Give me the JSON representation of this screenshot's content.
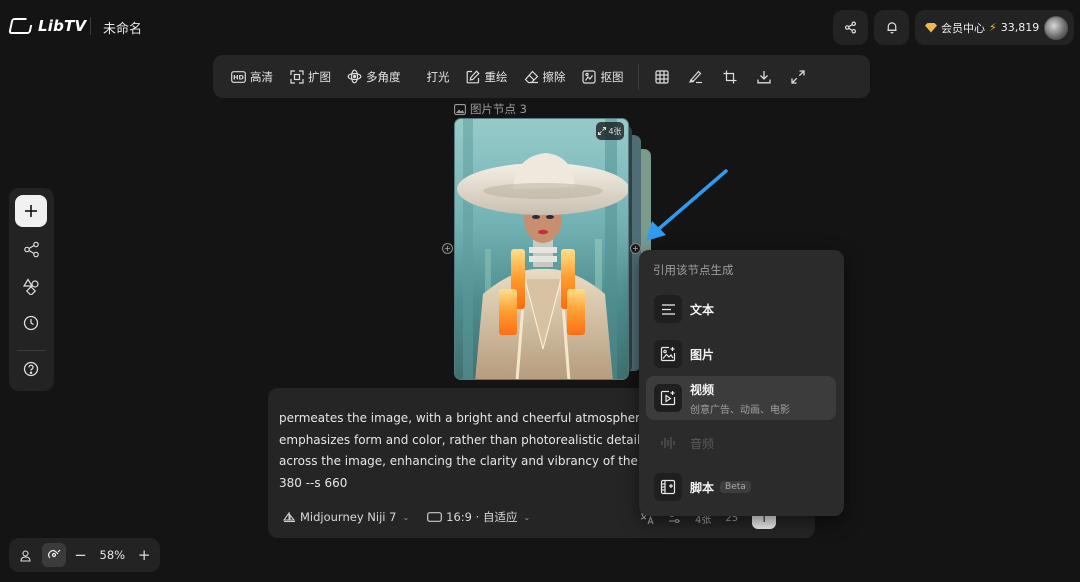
{
  "header": {
    "app_name": "LibTV",
    "doc_title": "未命名",
    "member_label": "会员中心",
    "credits": "33,819"
  },
  "toolbar": {
    "items": [
      {
        "label": "高清",
        "icon": "hd-icon"
      },
      {
        "label": "扩图",
        "icon": "expand-image-icon"
      },
      {
        "label": "多角度",
        "icon": "multi-angle-icon"
      },
      {
        "label": "打光",
        "icon": ""
      },
      {
        "label": "重绘",
        "icon": "redraw-icon"
      },
      {
        "label": "擦除",
        "icon": "eraser-icon"
      },
      {
        "label": "抠图",
        "icon": "cutout-icon"
      }
    ],
    "icon_buttons": [
      "grid-icon",
      "brush-icon",
      "crop-icon",
      "download-icon",
      "fullscreen-icon"
    ]
  },
  "node": {
    "label": "图片节点 3",
    "count_badge": "4张"
  },
  "sidebar": {
    "items": [
      "add-icon",
      "workflow-icon",
      "shapes-icon",
      "history-icon",
      "help-icon"
    ]
  },
  "zoom": {
    "value": "58%",
    "minus": "−",
    "plus": "+"
  },
  "prompt": {
    "lines": [
      "permeates the image, with a bright and cheerful atmosphere. The",
      "emphasizes form and color, rather than photorealistic detail. The",
      "across the image, enhancing the clarity and vibrancy of the color",
      "380 --s 660"
    ],
    "model": "Midjourney Niji 7",
    "ratio": "16:9 · 自适应",
    "count": "4张",
    "cost": "25"
  },
  "menu": {
    "title": "引用该节点生成",
    "items": [
      {
        "label": "文本",
        "sub": "",
        "icon": "text-lines-icon",
        "state": "normal"
      },
      {
        "label": "图片",
        "sub": "",
        "icon": "image-spark-icon",
        "state": "normal"
      },
      {
        "label": "视频",
        "sub": "创意广告、动画、电影",
        "icon": "video-spark-icon",
        "state": "hover"
      },
      {
        "label": "音频",
        "sub": "",
        "icon": "audio-wave-icon",
        "state": "disabled"
      },
      {
        "label": "脚本",
        "sub": "",
        "badge": "Beta",
        "icon": "script-film-icon",
        "state": "normal"
      }
    ]
  },
  "colors": {
    "background": "#141414",
    "panel": "#252525",
    "accent_arrow": "#2f9bf0",
    "gem": "#f1b84a"
  }
}
